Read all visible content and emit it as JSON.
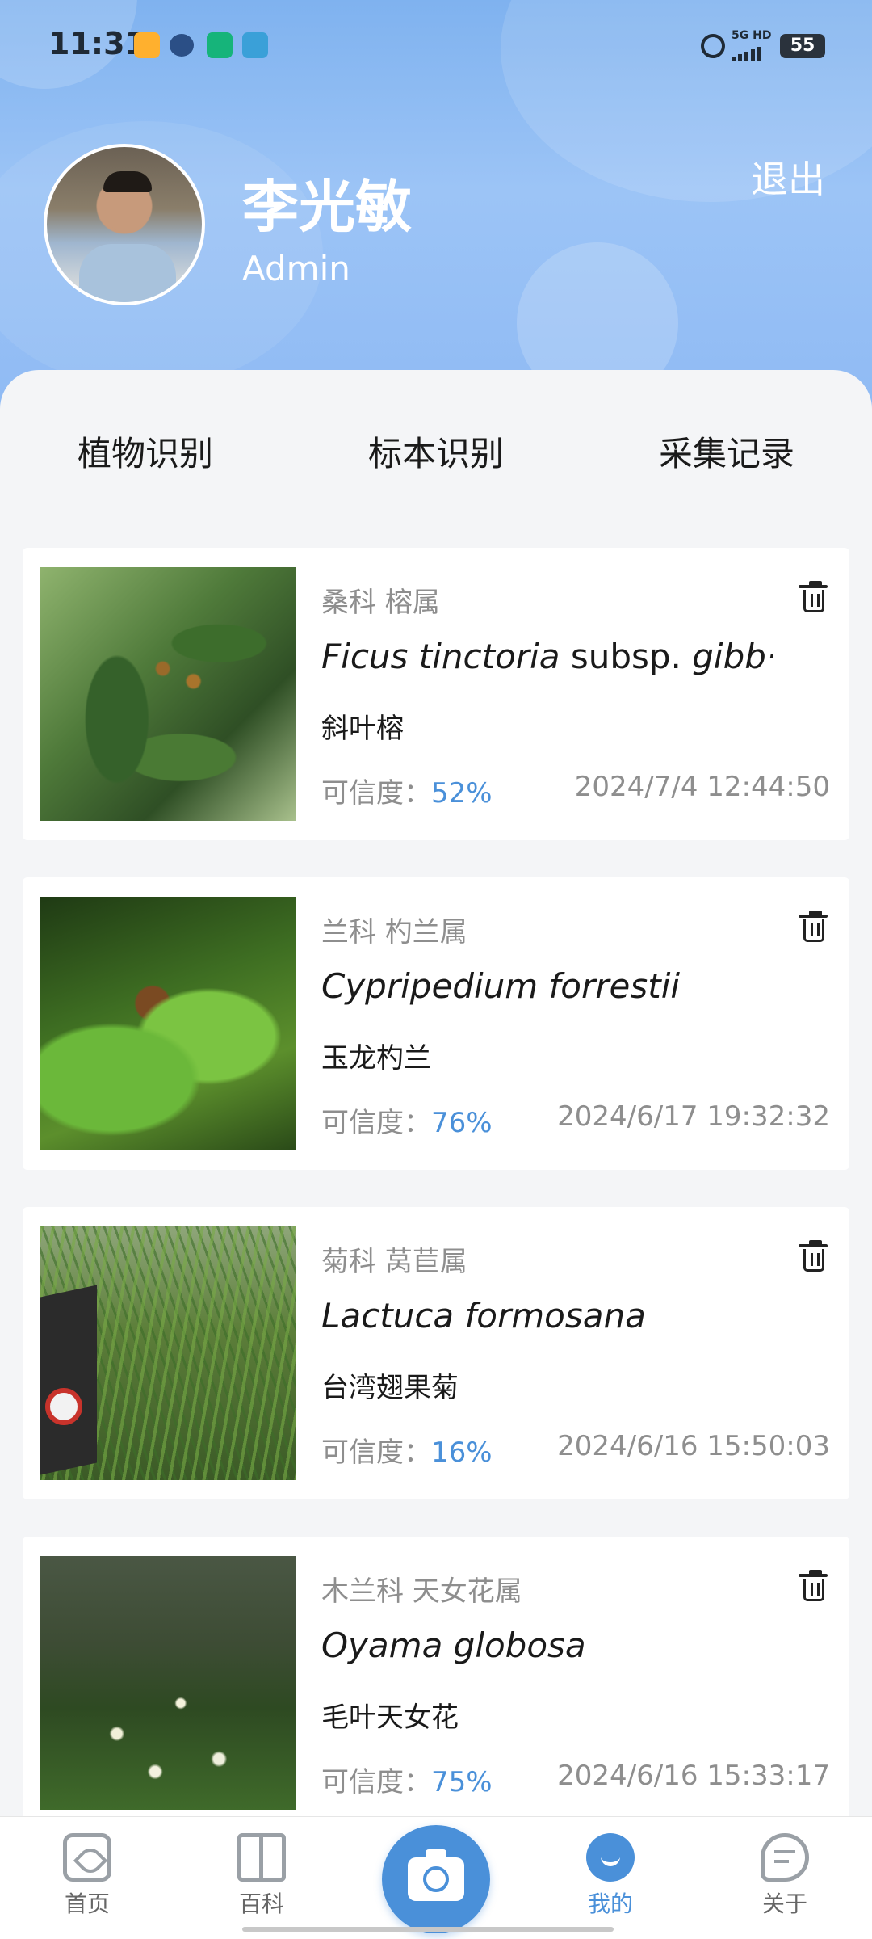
{
  "status": {
    "time": "11:31",
    "network": "5G HD",
    "battery": "55"
  },
  "profile": {
    "name": "李光敏",
    "role": "Admin",
    "logout_label": "退出"
  },
  "tabs": [
    {
      "label": "植物识别",
      "active": true
    },
    {
      "label": "标本识别",
      "active": false
    },
    {
      "label": "采集记录",
      "active": false
    }
  ],
  "confidence_label": "可信度：",
  "records": [
    {
      "family": "桑科 榕属",
      "sci_genus_species": "Ficus tinctoria",
      "sci_rank": " subsp. ",
      "sci_infra": "gibb···",
      "common_name": "斜叶榕",
      "confidence": "52%",
      "date": "2024/7/4 12:44:50"
    },
    {
      "family": "兰科 杓兰属",
      "sci_genus_species": "Cypripedium forrestii",
      "sci_rank": "",
      "sci_infra": "",
      "common_name": "玉龙杓兰",
      "confidence": "76%",
      "date": "2024/6/17 19:32:32"
    },
    {
      "family": "菊科 莴苣属",
      "sci_genus_species": "Lactuca formosana",
      "sci_rank": "",
      "sci_infra": "",
      "common_name": "台湾翅果菊",
      "confidence": "16%",
      "date": "2024/6/16 15:50:03"
    },
    {
      "family": "木兰科 天女花属",
      "sci_genus_species": "Oyama globosa",
      "sci_rank": "",
      "sci_infra": "",
      "common_name": "毛叶天女花",
      "confidence": "75%",
      "date": "2024/6/16 15:33:17"
    }
  ],
  "bottom_nav": {
    "home": "首页",
    "encyclopedia": "百科",
    "mine": "我的",
    "about": "关于",
    "active": "mine"
  },
  "colors": {
    "accent": "#4a90d9",
    "header_gradient_top": "#7fb2ef",
    "text_muted": "#8e8e8e"
  }
}
